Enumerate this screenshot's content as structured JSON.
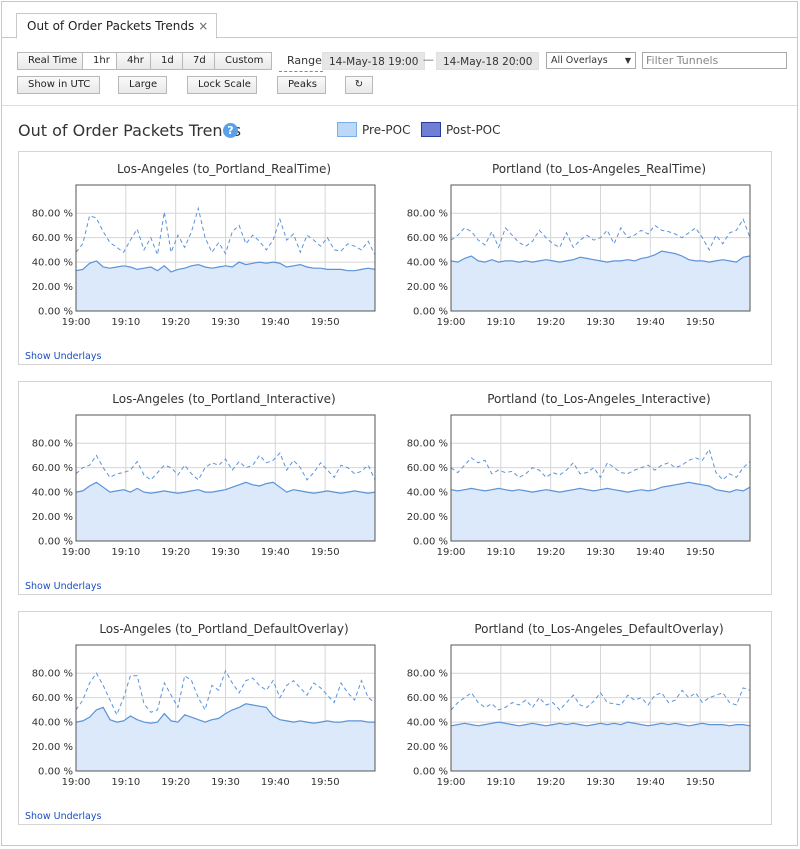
{
  "tab": {
    "label": "Out of Order Packets Trends",
    "close": "×"
  },
  "toolbar": {
    "time_buttons": [
      "Real Time",
      "1hr",
      "4hr",
      "1d",
      "7d",
      "Custom"
    ],
    "active_time": "1hr",
    "range_label": "Range",
    "range_start": "14-May-18 19:00",
    "range_sep": "—",
    "range_end": "14-May-18 20:00",
    "overlay_select": "All Overlays",
    "filter_placeholder": "Filter Tunnels",
    "show_utc": "Show in UTC",
    "large": "Large",
    "lock_scale": "Lock Scale",
    "peaks": "Peaks",
    "refresh_icon": "↻"
  },
  "page": {
    "title": "Out of Order Packets Trends",
    "help": "?"
  },
  "legend": [
    {
      "name": "Pre-POC",
      "fill": "#bcd8f7",
      "stroke": "#7aaee6"
    },
    {
      "name": "Post-POC",
      "fill": "#6f7fd6",
      "stroke": "#2a3a9a"
    }
  ],
  "colors": {
    "line": "#5b93d8",
    "area": "#dbe9fb",
    "grid": "#d6d6d6",
    "link": "#1a4fbf"
  },
  "show_underlays": "Show Underlays",
  "chart_data": [
    {
      "type": "area",
      "title": "Los-Angeles (to_Portland_RealTime)",
      "yticks": [
        "80.00 %",
        "60.00 %",
        "40.00 %",
        "20.00 %",
        "0.00 %"
      ],
      "xticks": [
        "19:00",
        "19:10",
        "19:20",
        "19:30",
        "19:40",
        "19:50"
      ],
      "ylim": [
        0,
        100
      ],
      "series": [
        {
          "style": "dashed",
          "values": [
            48,
            55,
            78,
            76,
            65,
            56,
            52,
            48,
            58,
            67,
            50,
            60,
            46,
            81,
            48,
            62,
            52,
            65,
            84,
            60,
            48,
            56,
            47,
            65,
            70,
            55,
            62,
            57,
            50,
            58,
            75,
            58,
            63,
            48,
            62,
            58,
            53,
            60,
            50,
            49,
            55,
            53,
            50,
            57,
            46
          ]
        },
        {
          "style": "solid",
          "values": [
            33,
            34,
            39,
            41,
            36,
            35,
            36,
            37,
            36,
            34,
            35,
            36,
            33,
            37,
            32,
            34,
            35,
            37,
            38,
            36,
            35,
            36,
            37,
            36,
            40,
            38,
            39,
            40,
            39,
            40,
            39,
            36,
            37,
            38,
            36,
            35,
            35,
            34,
            34,
            34,
            33,
            33,
            34,
            35,
            34
          ]
        }
      ]
    },
    {
      "type": "area",
      "title": "Portland (to_Los-Angeles_RealTime)",
      "yticks": [
        "80.00 %",
        "60.00 %",
        "40.00 %",
        "20.00 %",
        "0.00 %"
      ],
      "xticks": [
        "19:00",
        "19:10",
        "19:20",
        "19:30",
        "19:40",
        "19:50"
      ],
      "ylim": [
        0,
        100
      ],
      "series": [
        {
          "style": "dashed",
          "values": [
            58,
            62,
            68,
            65,
            58,
            54,
            65,
            52,
            68,
            62,
            56,
            53,
            57,
            66,
            60,
            55,
            52,
            64,
            52,
            58,
            62,
            58,
            60,
            66,
            55,
            68,
            60,
            62,
            66,
            63,
            70,
            66,
            65,
            63,
            60,
            64,
            68,
            60,
            50,
            62,
            55,
            64,
            66,
            75,
            60
          ]
        },
        {
          "style": "solid",
          "values": [
            41,
            40,
            43,
            45,
            41,
            40,
            42,
            40,
            41,
            41,
            40,
            41,
            40,
            41,
            42,
            41,
            40,
            41,
            42,
            44,
            43,
            42,
            41,
            40,
            41,
            41,
            42,
            41,
            43,
            44,
            46,
            49,
            48,
            47,
            45,
            42,
            41,
            41,
            40,
            41,
            42,
            41,
            40,
            44,
            45
          ]
        }
      ]
    },
    {
      "type": "area",
      "title": "Los-Angeles (to_Portland_Interactive)",
      "yticks": [
        "80.00 %",
        "60.00 %",
        "40.00 %",
        "20.00 %",
        "0.00 %"
      ],
      "xticks": [
        "19:00",
        "19:10",
        "19:20",
        "19:30",
        "19:40",
        "19:50"
      ],
      "ylim": [
        0,
        100
      ],
      "series": [
        {
          "style": "dashed",
          "values": [
            55,
            60,
            62,
            70,
            60,
            52,
            55,
            56,
            58,
            65,
            54,
            50,
            56,
            62,
            60,
            54,
            62,
            55,
            50,
            60,
            64,
            62,
            67,
            58,
            65,
            60,
            62,
            70,
            64,
            66,
            72,
            58,
            66,
            60,
            50,
            56,
            64,
            58,
            52,
            62,
            60,
            55,
            57,
            62,
            50
          ]
        },
        {
          "style": "solid",
          "values": [
            40,
            41,
            45,
            48,
            44,
            40,
            41,
            42,
            40,
            43,
            40,
            39,
            40,
            41,
            40,
            39,
            40,
            41,
            42,
            40,
            40,
            41,
            42,
            44,
            46,
            48,
            46,
            45,
            47,
            48,
            44,
            40,
            42,
            41,
            40,
            39,
            40,
            41,
            40,
            39,
            40,
            41,
            40,
            39,
            40
          ]
        }
      ]
    },
    {
      "type": "area",
      "title": "Portland (to_Los-Angeles_Interactive)",
      "yticks": [
        "80.00 %",
        "60.00 %",
        "40.00 %",
        "20.00 %",
        "0.00 %"
      ],
      "xticks": [
        "19:00",
        "19:10",
        "19:20",
        "19:30",
        "19:40",
        "19:50"
      ],
      "ylim": [
        0,
        100
      ],
      "series": [
        {
          "style": "dashed",
          "values": [
            60,
            56,
            62,
            68,
            64,
            66,
            55,
            58,
            56,
            57,
            52,
            55,
            60,
            58,
            52,
            56,
            54,
            58,
            64,
            55,
            56,
            60,
            52,
            64,
            60,
            56,
            55,
            58,
            60,
            62,
            58,
            62,
            64,
            60,
            62,
            66,
            68,
            66,
            75,
            56,
            50,
            55,
            52,
            60,
            65
          ]
        },
        {
          "style": "solid",
          "values": [
            42,
            41,
            42,
            43,
            42,
            41,
            42,
            43,
            42,
            41,
            42,
            41,
            40,
            41,
            42,
            41,
            40,
            41,
            42,
            43,
            42,
            41,
            42,
            43,
            42,
            41,
            40,
            41,
            42,
            41,
            42,
            44,
            45,
            46,
            47,
            48,
            47,
            46,
            45,
            42,
            41,
            40,
            42,
            41,
            44
          ]
        }
      ]
    },
    {
      "type": "area",
      "title": "Los-Angeles (to_Portland_DefaultOverlay)",
      "yticks": [
        "80.00 %",
        "60.00 %",
        "40.00 %",
        "20.00 %",
        "0.00 %"
      ],
      "xticks": [
        "19:00",
        "19:10",
        "19:20",
        "19:30",
        "19:40",
        "19:50"
      ],
      "ylim": [
        0,
        100
      ],
      "series": [
        {
          "style": "dashed",
          "values": [
            50,
            58,
            72,
            80,
            70,
            58,
            46,
            60,
            78,
            78,
            55,
            48,
            50,
            72,
            62,
            52,
            78,
            74,
            60,
            50,
            70,
            66,
            82,
            72,
            64,
            74,
            76,
            70,
            66,
            74,
            60,
            70,
            74,
            68,
            62,
            72,
            68,
            62,
            56,
            72,
            64,
            58,
            74,
            60,
            56
          ]
        },
        {
          "style": "solid",
          "values": [
            40,
            41,
            44,
            50,
            52,
            42,
            40,
            41,
            45,
            42,
            40,
            39,
            40,
            47,
            41,
            40,
            46,
            44,
            42,
            40,
            42,
            43,
            47,
            50,
            52,
            55,
            54,
            53,
            52,
            45,
            42,
            41,
            40,
            41,
            40,
            39,
            40,
            41,
            40,
            40,
            41,
            41,
            41,
            40,
            40
          ]
        }
      ]
    },
    {
      "type": "area",
      "title": "Portland (to_Los-Angeles_DefaultOverlay)",
      "yticks": [
        "80.00 %",
        "60.00 %",
        "40.00 %",
        "20.00 %",
        "0.00 %"
      ],
      "xticks": [
        "19:00",
        "19:10",
        "19:20",
        "19:30",
        "19:40",
        "19:50"
      ],
      "ylim": [
        0,
        100
      ],
      "series": [
        {
          "style": "dashed",
          "values": [
            50,
            56,
            60,
            64,
            56,
            52,
            55,
            50,
            52,
            56,
            54,
            58,
            52,
            60,
            54,
            56,
            50,
            56,
            62,
            54,
            52,
            57,
            64,
            56,
            55,
            54,
            62,
            58,
            60,
            54,
            62,
            64,
            56,
            58,
            66,
            60,
            64,
            56,
            60,
            62,
            64,
            56,
            54,
            68,
            66
          ]
        },
        {
          "style": "solid",
          "values": [
            37,
            38,
            39,
            38,
            37,
            38,
            39,
            40,
            39,
            38,
            37,
            38,
            39,
            38,
            37,
            38,
            39,
            38,
            39,
            38,
            37,
            38,
            39,
            38,
            39,
            38,
            40,
            39,
            38,
            37,
            38,
            39,
            38,
            39,
            38,
            37,
            38,
            39,
            38,
            38,
            38,
            37,
            38,
            38,
            37
          ]
        }
      ]
    }
  ]
}
